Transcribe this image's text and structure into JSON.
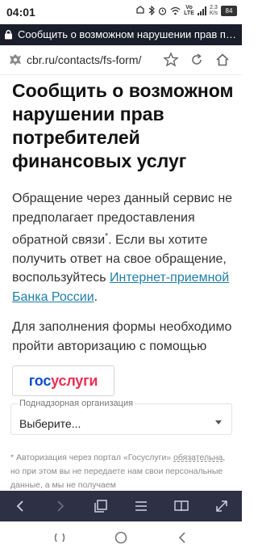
{
  "status": {
    "time": "04:01",
    "icons": [
      "notification-icon",
      "bluetooth-icon",
      "alarm-icon",
      "wifi-icon",
      "signal-icon",
      "battery-icon"
    ],
    "lte_top": "Vo",
    "lte_bottom": "LTE",
    "speed_top": "2.3",
    "speed_bottom": "K/s",
    "battery": "84"
  },
  "title_bar": {
    "text": "Сообщить о возможном нарушении прав потреб…"
  },
  "address": {
    "url": "cbr.ru/contacts/fs-form/",
    "icons": [
      "star-icon",
      "reload-icon",
      "home-icon"
    ]
  },
  "page": {
    "title": "Сообщить о возможном нарушении прав потребителей финансовых услуг",
    "notice_part1": "Обращение через данный сервис не предполагает предоставления обратной связи",
    "notice_star": "*",
    "notice_part2": ". Если вы хотите получить ответ на свое обращение, воспользуйтесь ",
    "notice_link": "Интернет-приемной Банка России",
    "notice_end": ".",
    "auth_text": "Для заполнения формы необходимо пройти авторизацию с помощью",
    "gosuslugi_blue": "гос",
    "gosuslugi_red": "услуги"
  },
  "form": {
    "org_label": "Поднадзорная организация",
    "org_value": "Выберите..."
  },
  "footnote": {
    "star": "* ",
    "part1": "Авторизация через портал «Госуслуги» ",
    "dashed": "обязательна",
    "part2": ", но при этом вы не передаете нам свои персональные данные, а мы не получаем"
  },
  "colors": {
    "title_strip": "#1a1d2a",
    "browser_nav": "#2e3145",
    "link": "#1f7ea8",
    "gos_blue": "#0d4cd3",
    "gos_red": "#ee2f53"
  }
}
